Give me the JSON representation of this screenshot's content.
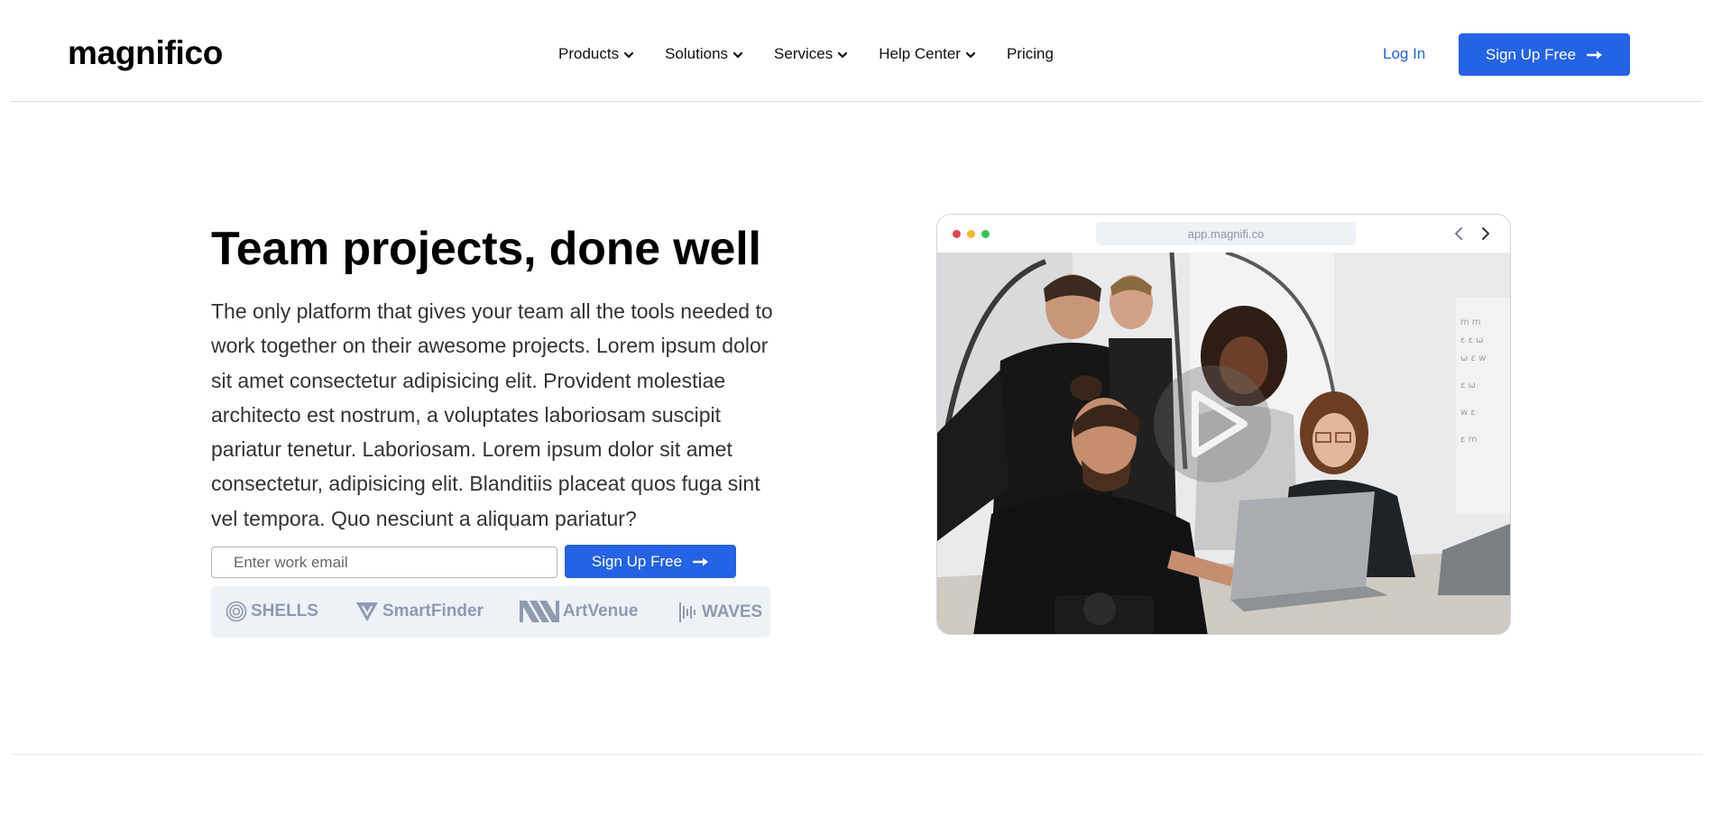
{
  "header": {
    "logo": "magnifico",
    "nav": [
      {
        "label": "Products",
        "dropdown": true
      },
      {
        "label": "Solutions",
        "dropdown": true
      },
      {
        "label": "Services",
        "dropdown": true
      },
      {
        "label": "Help Center",
        "dropdown": true
      },
      {
        "label": "Pricing",
        "dropdown": false
      }
    ],
    "login_label": "Log In",
    "signup_label": "Sign Up Free"
  },
  "hero": {
    "title": "Team projects, done well",
    "description": "The only platform that gives your team all the tools needed to work together on their awesome projects. Lorem ipsum dolor sit amet consectetur adipisicing elit. Provident molestiae architecto est nostrum, a voluptates laboriosam suscipit pariatur tenetur. Laboriosam. Lorem ipsum dolor sit amet consectetur, adipisicing elit. Blanditiis placeat quos fuga sint vel tempora. Quo nesciunt a aliquam pariatur?",
    "email_placeholder": "Enter work email",
    "signup_label": "Sign Up Free"
  },
  "logos": [
    {
      "name": "SHELLS",
      "icon": "shell-spiral-icon"
    },
    {
      "name": "SmartFinder",
      "icon": "shield-v-icon"
    },
    {
      "name": "ArtVenue",
      "icon": "stripes-icon"
    },
    {
      "name": "WAVES",
      "icon": "soundwave-icon"
    }
  ],
  "browser": {
    "url": "app.magnifi.co",
    "photo_icon": "team-working-at-laptop-photo",
    "overlay_icon": "play-icon"
  },
  "colors": {
    "primary": "#2462e6",
    "link": "#1f63e0",
    "logo_strip_bg": "#eef1f6",
    "logo_gray": "#8e9bb0",
    "dot_red": "#ee3e54",
    "dot_yellow": "#f5b82e",
    "dot_green": "#2dc653"
  }
}
